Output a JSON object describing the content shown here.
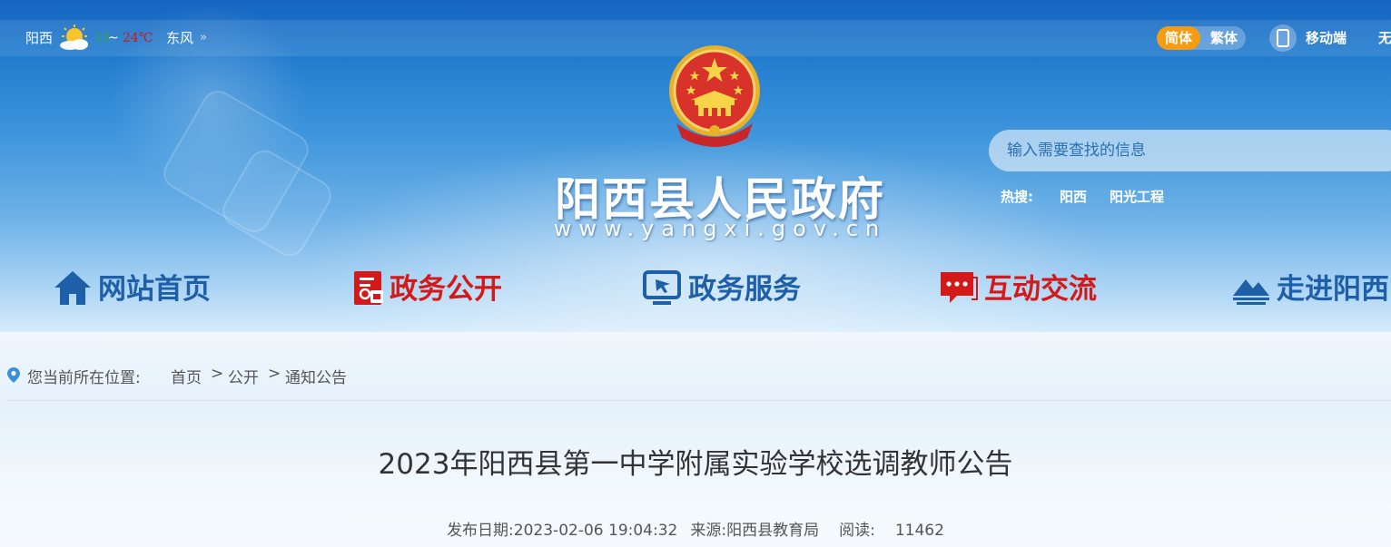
{
  "topbar": {
    "city": "阳西",
    "weather_icon": "sun-cloud-icon",
    "temp_low": "19",
    "temp_sep": "~",
    "temp_high": "24℃",
    "wind": "东风",
    "wind_chevron": "»",
    "lang_simplified": "简体",
    "lang_traditional": "繁体",
    "mobile_label": "移动端",
    "accessibility_label": "无"
  },
  "header": {
    "site_title": "阳西县人民政府",
    "site_url": "www.yangxi.gov.cn"
  },
  "search": {
    "placeholder": "输入需要查找的信息",
    "hot_label": "热搜:",
    "hot_items": [
      "阳西",
      "阳光工程"
    ]
  },
  "nav": {
    "items": [
      {
        "label": "网站首页",
        "icon": "home-icon",
        "color": "#1f5fa8"
      },
      {
        "label": "政务公开",
        "icon": "document-icon",
        "color": "#d21a1a"
      },
      {
        "label": "政务服务",
        "icon": "service-screen-icon",
        "color": "#1f5fa8"
      },
      {
        "label": "互动交流",
        "icon": "chat-icon",
        "color": "#d21a1a"
      },
      {
        "label": "走进阳西",
        "icon": "mountain-icon",
        "color": "#1f5fa8"
      }
    ]
  },
  "breadcrumb": {
    "prefix": "您当前所在位置:",
    "items": [
      "首页",
      "公开",
      "通知公告"
    ],
    "separator": ">"
  },
  "article": {
    "title": "2023年阳西县第一中学附属实验学校选调教师公告",
    "date_label": "发布日期:",
    "date": "2023-02-06 19:04:32",
    "source_label": "来源:",
    "source": "阳西县教育局",
    "views_label": "阅读:",
    "views": "11462"
  },
  "colors": {
    "accent_blue": "#1f5fa8",
    "accent_red": "#d21a1a",
    "lang_active": "#f59c13"
  }
}
